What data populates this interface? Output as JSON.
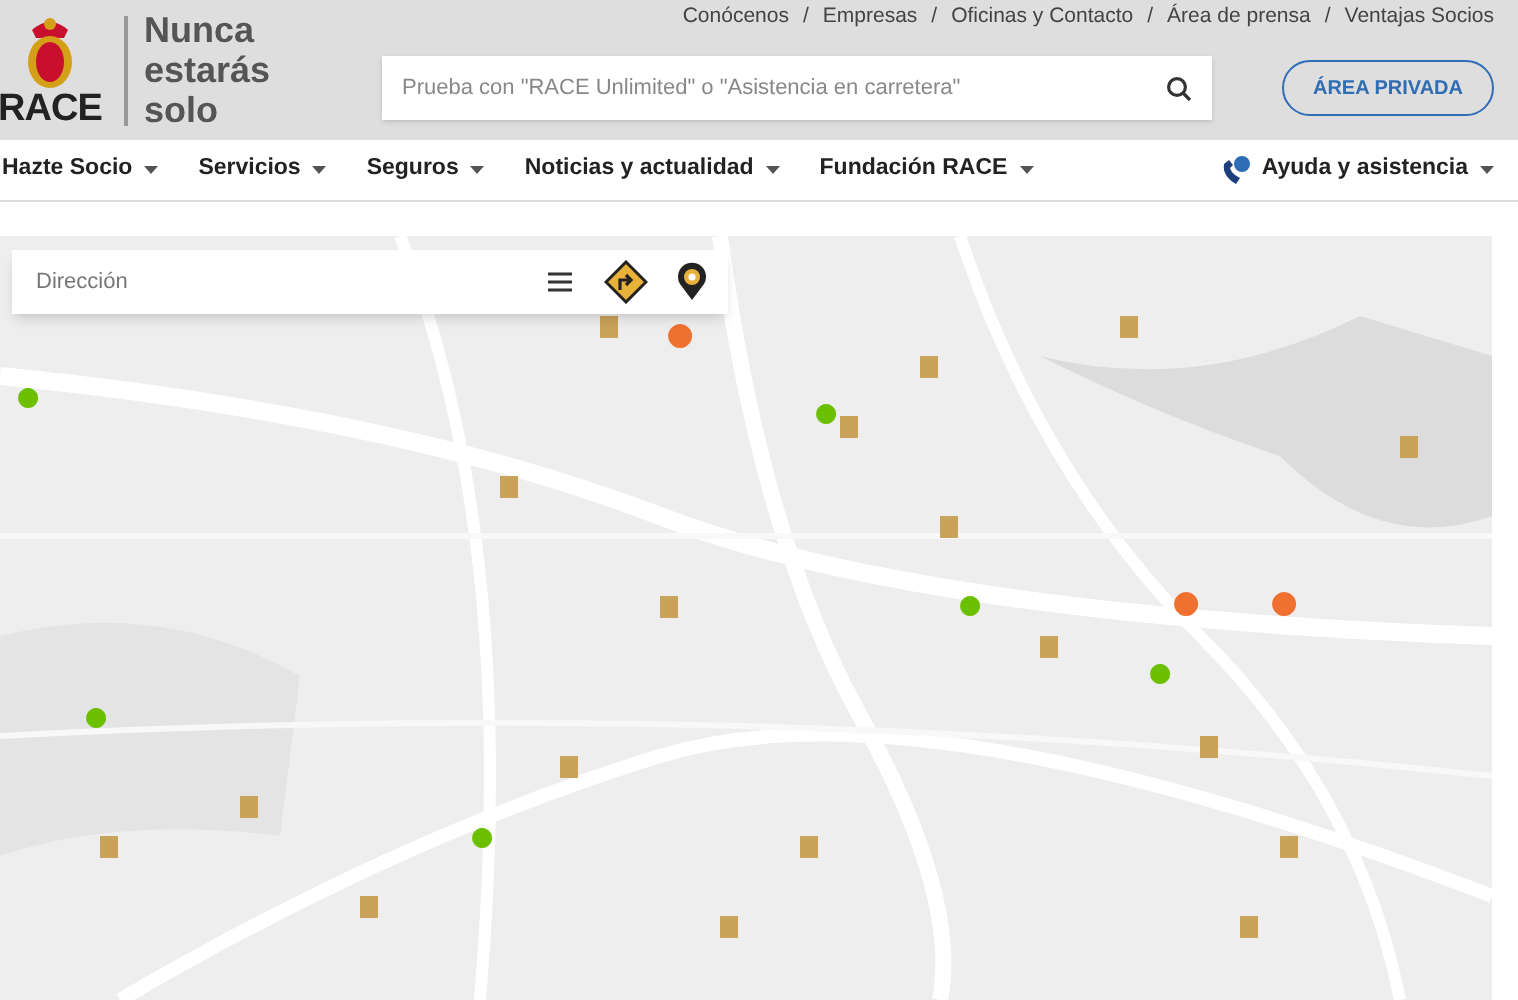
{
  "header": {
    "logo_text": "RACE",
    "tagline": "Nunca estarás solo",
    "top_links": [
      {
        "label": "Conócenos"
      },
      {
        "label": "Empresas"
      },
      {
        "label": "Oficinas y Contacto"
      },
      {
        "label": "Área de prensa"
      },
      {
        "label": "Ventajas Socios"
      }
    ],
    "separator": "/",
    "search": {
      "placeholder": "Prueba con \"RACE Unlimited\" o \"Asistencia en carretera\""
    },
    "private_button": "ÁREA PRIVADA"
  },
  "nav": {
    "items": [
      {
        "label": "Hazte Socio"
      },
      {
        "label": "Servicios"
      },
      {
        "label": "Seguros"
      },
      {
        "label": "Noticias y actualidad"
      },
      {
        "label": "Fundación RACE"
      }
    ],
    "help": "Ayuda y asistencia"
  },
  "map": {
    "kind": "picture",
    "search": {
      "placeholder": "Dirección"
    }
  }
}
